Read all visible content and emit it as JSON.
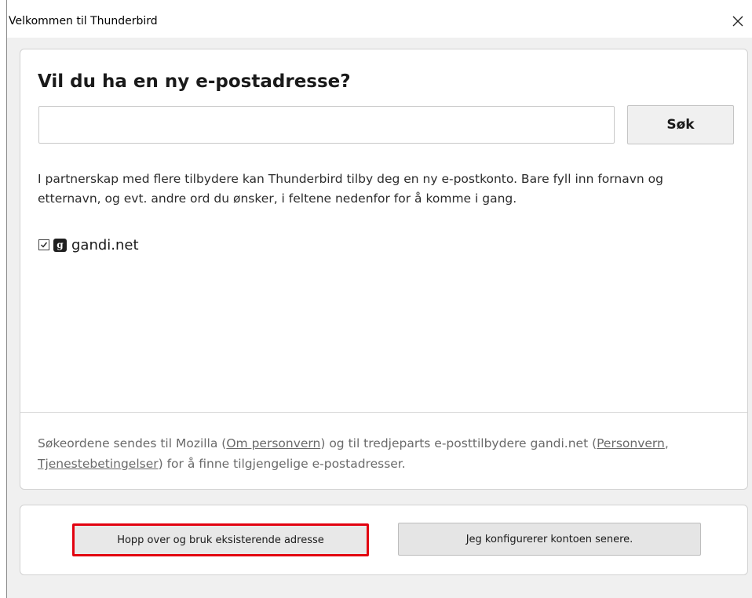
{
  "window": {
    "title": "Velkommen til Thunderbird",
    "close_glyph": "✕"
  },
  "main": {
    "heading": "Vil du ha en ny e-postadresse?",
    "search": {
      "value": "",
      "placeholder": "",
      "button_label": "Søk"
    },
    "description": "I partnerskap med flere tilbydere kan Thunderbird tilby deg en ny e-postkonto. Bare fyll inn fornavn og etternavn, og evt. andre ord du ønsker, i feltene nedenfor for å komme i gang.",
    "providers": [
      {
        "name": "gandi.net",
        "checked": true,
        "icon": "gandi-logo-icon",
        "icon_glyph": "g"
      }
    ],
    "disclaimer": {
      "part1": "Søkeordene sendes til Mozilla (",
      "link_privacy_mozilla": "Om personvern",
      "part2": ") og til tredjeparts e-posttilbydere gandi.net (",
      "link_privacy_provider": "Personvern",
      "part3": ", ",
      "link_terms": "Tjenestebetingelser",
      "part4": ") for å finne tilgjengelige e-postadresser."
    }
  },
  "footer": {
    "skip_button": "Hopp over og bruk eksisterende adresse",
    "later_button": "Jeg konfigurerer kontoen senere."
  },
  "colors": {
    "highlight": "#e2000f",
    "window_bg": "#f0f0f0",
    "panel_bg": "#ffffff"
  }
}
